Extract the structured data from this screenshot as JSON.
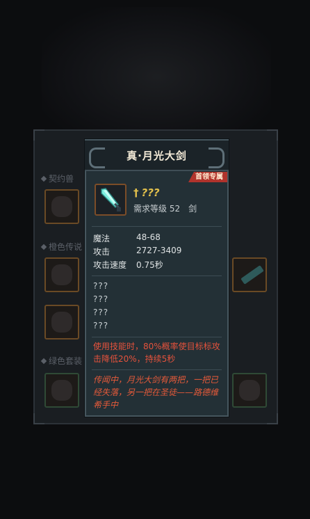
{
  "item": {
    "title": "真·月光大剑",
    "badge": "首领专属",
    "name_mark": "†",
    "name": "???",
    "requirement": "需求等级 52",
    "type": "剑",
    "icon": "sword-icon"
  },
  "stats": [
    {
      "label": "魔法",
      "value": "48-68"
    },
    {
      "label": "攻击",
      "value": "2727-3409"
    },
    {
      "label": "攻击速度",
      "value": "0.75秒"
    }
  ],
  "unknown_affixes": [
    "???",
    "???",
    "???",
    "???"
  ],
  "effect": "使用技能时，80%概率使目标标攻击降低20%，持续5秒",
  "lore": "传闻中，月光大剑有两把，一把已经失落，另一把在圣徒——路德维希手中",
  "background": {
    "section_1": "契约兽",
    "section_2": "橙色传说",
    "section_3": "绿色套装"
  },
  "colors": {
    "title": "#f3ead7",
    "item_name": "#e2c04c",
    "effect": "#e5523c",
    "badge": "#b0332c",
    "icon_border": "#7c4d28"
  }
}
